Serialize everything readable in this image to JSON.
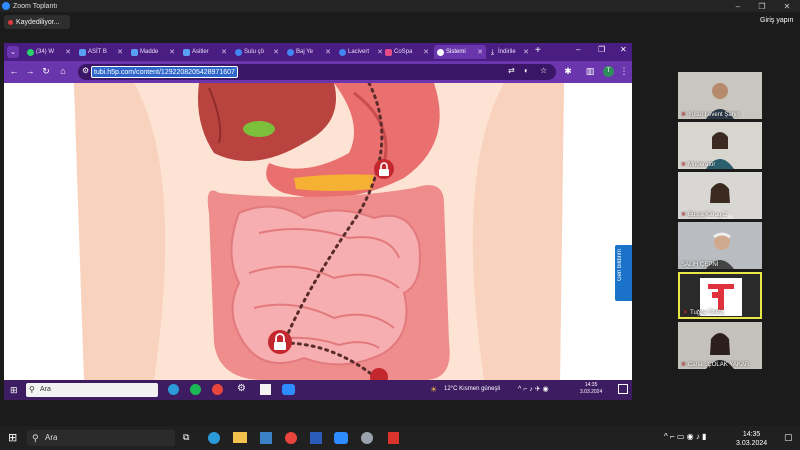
{
  "zoom": {
    "title": "Zoom Toplantı",
    "recording_label": "Kaydediliyor...",
    "sign_in": "Giriş yapın",
    "minimize": "–",
    "maximize": "❐",
    "close": "✕"
  },
  "browser": {
    "tabs": [
      {
        "label": "(34) W",
        "color": "#25d366"
      },
      {
        "label": "ASİT B",
        "color": "#e8f0fe"
      },
      {
        "label": "Madde",
        "color": "#e8f0fe"
      },
      {
        "label": "Asitler",
        "color": "#e8f0fe"
      },
      {
        "label": "Sulu çö",
        "color": "#4285f4"
      },
      {
        "label": "Baj Ye",
        "color": "#4285f4"
      },
      {
        "label": "Lacivert",
        "color": "#4285f4"
      },
      {
        "label": "CoSpa",
        "color": "#e34b86"
      },
      {
        "label": "Sistemi",
        "color": "#ffffff"
      },
      {
        "label": "İndirile",
        "color": "#ffffff"
      }
    ],
    "new_tab": "+",
    "url": "tubi.h5p.com/content/1292208205428971607",
    "profile_initial": "T",
    "feedback_label": "Geri bildirim"
  },
  "remote_taskbar": {
    "search_placeholder": "Ara",
    "weather": "12°C  Kısmen güneşli",
    "time": "14:35",
    "date": "3.03.2024"
  },
  "participants": [
    {
      "name": "Yusuf Levent Şahin",
      "muted": true
    },
    {
      "name": "Moderatör",
      "muted": true
    },
    {
      "name": "Büşra Karagöz",
      "muted": true
    },
    {
      "name": "SALİH ÇEPNİ",
      "muted": false
    },
    {
      "name": "Tuğba ÜNAL",
      "muted": true,
      "active_speaker": true
    },
    {
      "name": "Canan ÇOLAK YAKAR",
      "muted": true
    }
  ],
  "taskbar": {
    "search_placeholder": "Ara",
    "time": "14:35",
    "date": "3.03.2024"
  },
  "colors": {
    "browser_frame": "#4a1d82",
    "browser_toolbar": "#6a35ad",
    "active_speaker_border": "#e8e84a",
    "feedback_button": "#1a73c9"
  }
}
